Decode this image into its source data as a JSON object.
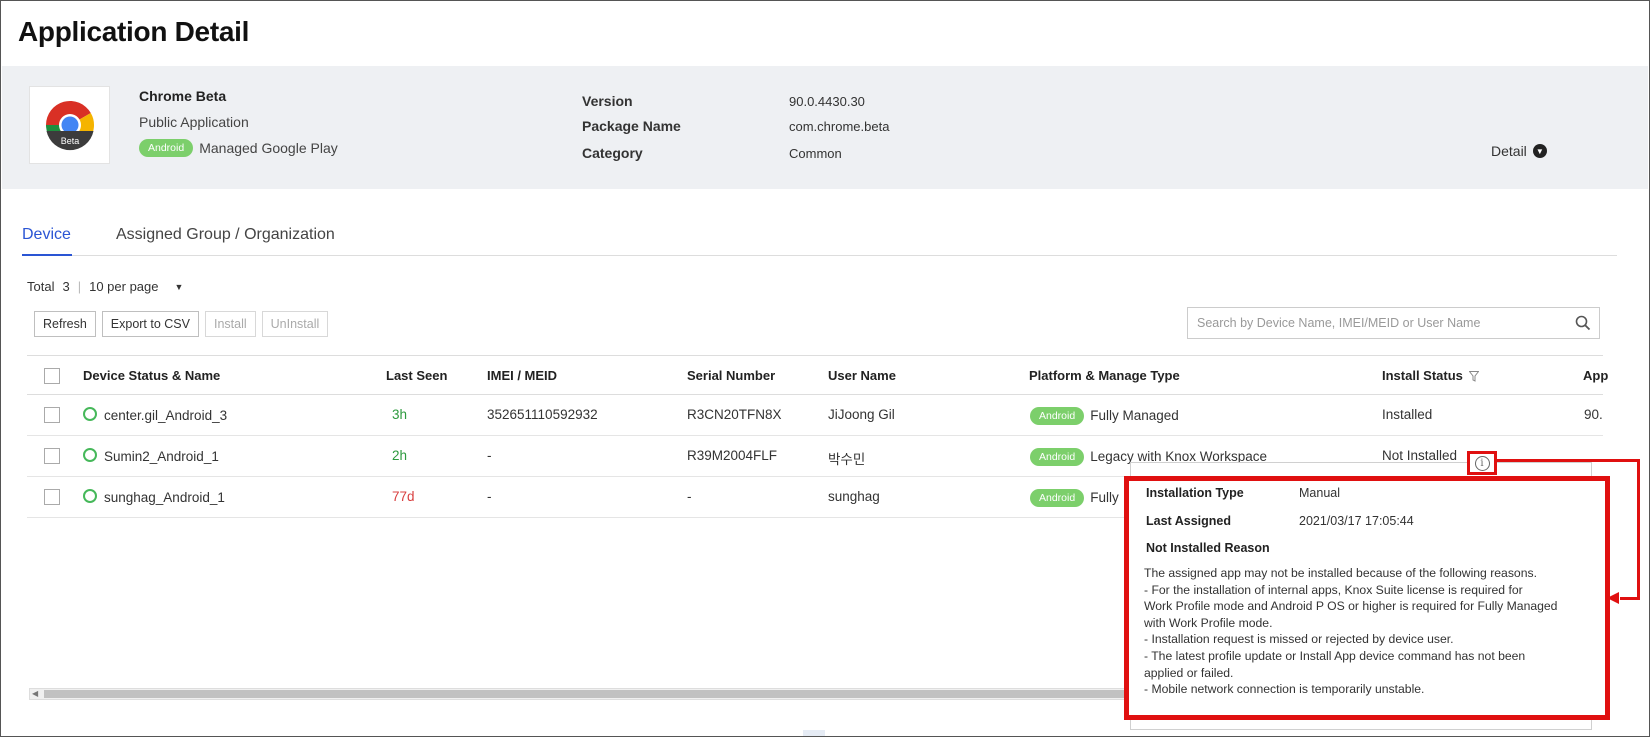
{
  "page": {
    "title": "Application Detail"
  },
  "app": {
    "name": "Chrome Beta",
    "type": "Public Application",
    "platform_badge": "Android",
    "store": "Managed Google Play",
    "icon_label": "Beta",
    "details": [
      {
        "label": "Version",
        "value": "90.0.4430.30"
      },
      {
        "label": "Package Name",
        "value": "com.chrome.beta"
      },
      {
        "label": "Category",
        "value": "Common"
      }
    ],
    "detail_link": "Detail"
  },
  "tabs": [
    {
      "label": "Device",
      "active": true
    },
    {
      "label": "Assigned Group / Organization",
      "active": false
    }
  ],
  "list": {
    "total_label": "Total",
    "total_count": "3",
    "per_page": "10 per page"
  },
  "toolbar": {
    "refresh": "Refresh",
    "export": "Export to CSV",
    "install": "Install",
    "uninstall": "UnInstall"
  },
  "search": {
    "placeholder": "Search by Device Name, IMEI/MEID or User Name"
  },
  "table": {
    "columns": {
      "device": "Device Status & Name",
      "last_seen": "Last Seen",
      "imei": "IMEI / MEID",
      "serial": "Serial Number",
      "user": "User Name",
      "platform": "Platform & Manage Type",
      "install_status": "Install Status",
      "app_version": "App"
    },
    "rows": [
      {
        "device": "center.gil_Android_3",
        "last_seen": "3h",
        "imei": "352651110592932",
        "serial": "R3CN20TFN8X",
        "user": "JiJoong Gil",
        "platform_badge": "Android",
        "manage_type": "Fully Managed",
        "install_status": "Installed",
        "app_version": "90."
      },
      {
        "device": "Sumin2_Android_1",
        "last_seen": "2h",
        "imei": "-",
        "serial": "R39M2004FLF",
        "user": "박수민",
        "platform_badge": "Android",
        "manage_type": "Legacy with Knox Workspace",
        "install_status": "Not Installed",
        "app_version": ""
      },
      {
        "device": "sunghag_Android_1",
        "last_seen": "77d",
        "imei": "-",
        "serial": "-",
        "user": "sunghag",
        "platform_badge": "Android",
        "manage_type": "Fully",
        "install_status": "",
        "app_version": ""
      }
    ]
  },
  "tooltip": {
    "installation_type_label": "Installation Type",
    "installation_type_value": "Manual",
    "last_assigned_label": "Last Assigned",
    "last_assigned_value": "2021/03/17 17:05:44",
    "reason_label": "Not Installed Reason",
    "lines": [
      "The assigned app may not be installed because of the following reasons.",
      "- For the installation of internal apps, Knox Suite license is required for",
      "Work Profile mode and Android P OS or higher is required for Fully Managed",
      "with Work Profile mode.",
      "- Installation request is missed or rejected by device user.",
      "- The latest profile update or Install App device command has not been",
      "applied or failed.",
      "- Mobile network connection is temporarily unstable."
    ]
  },
  "colors": {
    "accent": "#2a55d4",
    "android_badge": "#7ccf6b",
    "highlight": "#e01010",
    "status_online": "#46b85a",
    "last_seen_recent": "#2d9a3e",
    "last_seen_old": "#d94040"
  },
  "icons": {
    "app": "chrome-beta-icon",
    "detail": "chevron-down-circle-icon",
    "dropdown": "caret-down-icon",
    "search": "search-icon",
    "filter": "filter-icon",
    "info": "info-icon",
    "status": "status-circle-icon"
  }
}
